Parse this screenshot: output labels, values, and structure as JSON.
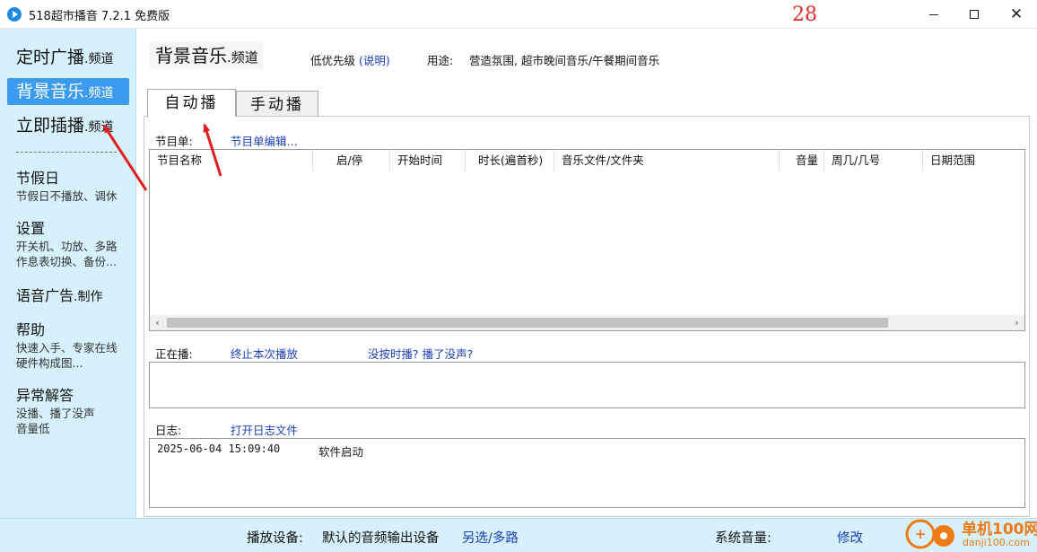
{
  "window": {
    "title": "518超市播音 7.2.1 免费版"
  },
  "sidebar": {
    "channels": [
      {
        "name": "定时广播",
        "suffix": ".频道"
      },
      {
        "name": "背景音乐",
        "suffix": ".频道"
      },
      {
        "name": "立即插播",
        "suffix": ".频道"
      }
    ],
    "active_channel_index": 1,
    "sections": [
      {
        "title": "节假日",
        "suffix": "",
        "desc": [
          "节假日不播放、调休"
        ]
      },
      {
        "title": "设置",
        "suffix": "",
        "desc": [
          "开关机、功放、多路",
          "作息表切换、备份..."
        ]
      },
      {
        "title": "语音广告",
        "suffix": ".制作",
        "desc": []
      },
      {
        "title": "帮助",
        "suffix": "",
        "desc": [
          "快速入手、专家在线",
          "硬件构成图..."
        ]
      },
      {
        "title": "异常解答",
        "suffix": "",
        "desc": [
          "没播、播了没声",
          "音量低"
        ]
      }
    ]
  },
  "header": {
    "title": "背景音乐",
    "title_suffix": ".频道",
    "priority_text": "低优先级",
    "priority_link": "(说明)",
    "usage_label": "用途:",
    "usage_value": "营造氛围, 超市晚间音乐/午餐期间音乐"
  },
  "tabs": [
    {
      "label": "自动播",
      "active": true
    },
    {
      "label": "手动播",
      "active": false
    }
  ],
  "program": {
    "label": "节目单:",
    "edit_link": "节目单编辑…",
    "columns": [
      "节目名称",
      "启/停",
      "开始时间",
      "时长(遍首秒)",
      "音乐文件/文件夹",
      "音量",
      "周几/几号",
      "日期范围"
    ],
    "rows": []
  },
  "now_playing": {
    "label": "正在播:",
    "stop_link": "终止本次播放",
    "help_link": "没按时播? 播了没声?"
  },
  "log": {
    "label": "日志:",
    "open_link": "打开日志文件",
    "entries": [
      {
        "time": "2025-06-04 15:09:40",
        "message": "软件启动"
      }
    ]
  },
  "statusbar": {
    "device_label": "播放设备:",
    "device_value": "默认的音频输出设备",
    "device_link": "另选/多路",
    "volume_label": "系统音量:",
    "volume_value": "28",
    "volume_link": "修改"
  },
  "watermark": {
    "site_name": "单机100网",
    "url": "danji100.com"
  },
  "colors": {
    "sidebar_bg": "#d6f1fb",
    "active_channel": "#3a9bf0",
    "link": "#1a3fb8",
    "volume": "#e32a2a",
    "annotation_arrow": "#e02020",
    "watermark": "#f07a13"
  }
}
